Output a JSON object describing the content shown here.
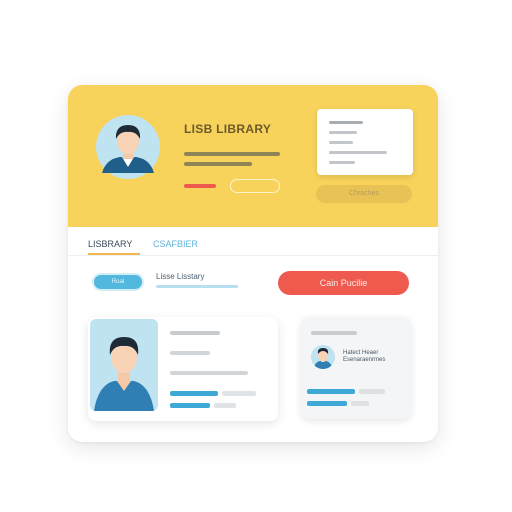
{
  "header": {
    "title": "LISB LIBRARY",
    "button_label": "Chraches"
  },
  "tabs": [
    {
      "label": "LISBRARY",
      "active": true
    },
    {
      "label": "CSAFBIER",
      "active": false
    }
  ],
  "filter_row": {
    "pill_label": "Roal",
    "label": "Lisse Lisstary",
    "cta_label": "Cain Pucilie"
  },
  "profile_card_2": {
    "name_line_1": "Hatect Heaer",
    "name_line_2": "Esenaraenrmes"
  },
  "colors": {
    "header_yellow": "#f7d35c",
    "accent_blue": "#53b8dd",
    "accent_red": "#ef5a4e",
    "tab_underline": "#f1b64c"
  },
  "icons": [
    "user-avatar-icon",
    "user-avatar-icon",
    "user-avatar-icon"
  ]
}
